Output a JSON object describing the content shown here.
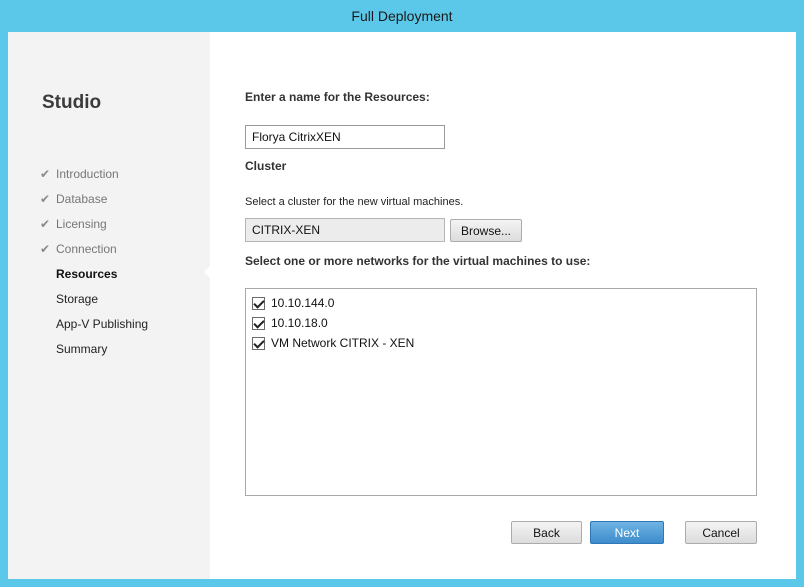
{
  "window": {
    "title": "Full Deployment"
  },
  "sidebar": {
    "brand": "Studio",
    "steps": [
      {
        "label": "Introduction",
        "state": "done"
      },
      {
        "label": "Database",
        "state": "done"
      },
      {
        "label": "Licensing",
        "state": "done"
      },
      {
        "label": "Connection",
        "state": "done"
      },
      {
        "label": "Resources",
        "state": "current"
      },
      {
        "label": "Storage",
        "state": "todo"
      },
      {
        "label": "App-V Publishing",
        "state": "todo"
      },
      {
        "label": "Summary",
        "state": "todo"
      }
    ]
  },
  "main": {
    "name_heading": "Enter a name for the Resources:",
    "name_value": "Florya CitrixXEN",
    "cluster_heading": "Cluster",
    "cluster_prompt": "Select a cluster for the new virtual machines.",
    "cluster_value": "CITRIX-XEN",
    "browse_label": "Browse...",
    "network_heading": "Select one or more networks for the virtual machines to use:",
    "networks": [
      {
        "label": "10.10.144.0",
        "checked": true
      },
      {
        "label": "10.10.18.0",
        "checked": true
      },
      {
        "label": "VM Network CITRIX - XEN",
        "checked": true
      }
    ]
  },
  "footer": {
    "back_label": "Back",
    "next_label": "Next",
    "cancel_label": "Cancel"
  },
  "colors": {
    "frame": "#5bc8ea",
    "primary_button": "#3d8ccc",
    "sidebar_bg": "#f3f3f3"
  }
}
